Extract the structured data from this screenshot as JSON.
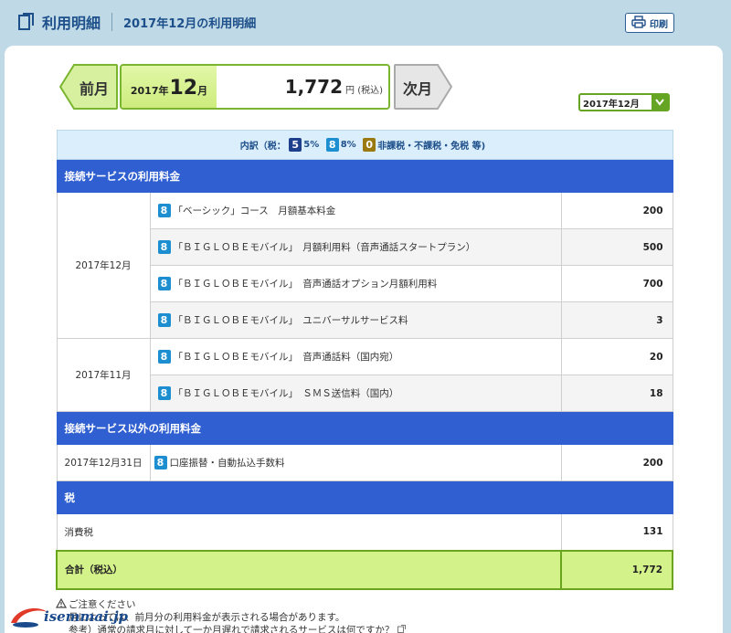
{
  "header": {
    "title": "利用明細",
    "subtitle": "2017年12月の利用明細",
    "print_label": "印刷"
  },
  "nav": {
    "prev_label": "前月",
    "next_label": "次月",
    "current_year": "2017年",
    "current_month": "12",
    "current_month_unit": "月",
    "current_amount": "1,772",
    "current_amount_unit": "円 (税込)",
    "select_value": "2017年12月"
  },
  "legend": {
    "prefix": "内訳（税：",
    "badge5": "5",
    "label5": "5%",
    "badge8": "8",
    "label8": "8%",
    "badge0": "0",
    "label0": "非課税・不課税・免税 等)"
  },
  "sections": {
    "connection": "接続サービスの利用料金",
    "other": "接続サービス以外の利用料金",
    "tax": "税"
  },
  "connection_groups": [
    {
      "date": "2017年12月",
      "items": [
        {
          "badge": "8",
          "desc": "「ベーシック」コース　月額基本料金",
          "value": "200"
        },
        {
          "badge": "8",
          "desc": "「ＢＩＧＬＯＢＥモバイル」　月額利用料（音声通話スタートプラン）",
          "value": "500"
        },
        {
          "badge": "8",
          "desc": "「ＢＩＧＬＯＢＥモバイル」　音声通話オプション月額利用料",
          "value": "700"
        },
        {
          "badge": "8",
          "desc": "「ＢＩＧＬＯＢＥモバイル」　ユニバーサルサービス料",
          "value": "3"
        }
      ]
    },
    {
      "date": "2017年11月",
      "items": [
        {
          "badge": "8",
          "desc": "「ＢＩＧＬＯＢＥモバイル」　音声通話料（国内宛）",
          "value": "20"
        },
        {
          "badge": "8",
          "desc": "「ＢＩＧＬＯＢＥモバイル」　ＳＭＳ送信料（国内）",
          "value": "18"
        }
      ]
    }
  ],
  "other_items": [
    {
      "date": "2017年12月31日",
      "badge": "8",
      "desc": "口座振替・自動払込手数料",
      "value": "200"
    }
  ],
  "tax": {
    "label": "消費税",
    "value": "131"
  },
  "total": {
    "label": "合計（税込）",
    "value": "1,772"
  },
  "notes": {
    "heading": "ご注意ください",
    "line1": "月によっては、前月分の利用料金が表示される場合があります。",
    "line2": "参考）通常の請求月に対して一か月遅れで請求されるサービスは何ですか？"
  },
  "logo": {
    "text": "isemmai.jp"
  },
  "colors": {
    "accent_green": "#7ab52f",
    "section_blue": "#2f5fd0",
    "legend_bg": "#dbeefc",
    "total_bg": "#d4f28a"
  }
}
